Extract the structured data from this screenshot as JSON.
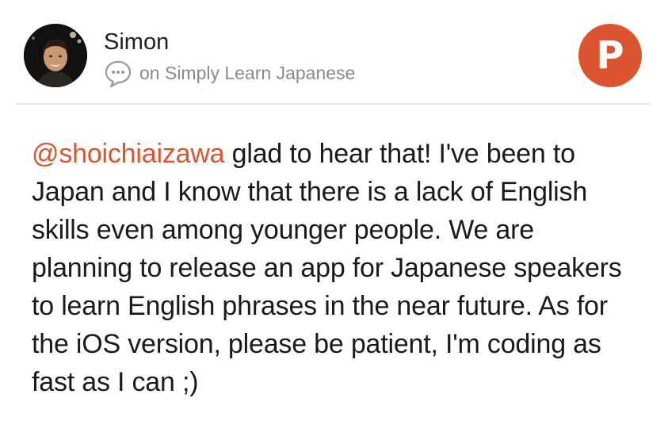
{
  "author": {
    "name": "Simon",
    "avatar_icon": "user-avatar-photo"
  },
  "context": {
    "icon": "comment-bubble-icon",
    "text": "on Simply Learn Japanese"
  },
  "badge": {
    "letter": "P",
    "color": "#da552f"
  },
  "comment": {
    "mention": "@shoichiaizawa",
    "text": " glad to hear that! I've been to Japan and I know that there is a lack of English skills even among younger people. We are planning to release an app for Japanese speakers to learn English phrases in the near future. As for the iOS version, please be patient, I'm coding as fast as I can ;)"
  },
  "colors": {
    "accent": "#da552f",
    "secondary_text": "#8a8a8a",
    "primary_text": "#1a1a1a"
  }
}
